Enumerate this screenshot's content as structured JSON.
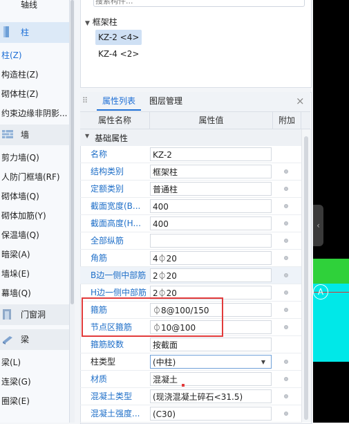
{
  "left_nav": {
    "top_item": "轴线",
    "items": [
      {
        "type": "group",
        "label": "柱",
        "icon": "column-icon",
        "active": true
      },
      {
        "type": "item",
        "label": "柱(Z)",
        "selected": true
      },
      {
        "type": "item",
        "label": "构造柱(Z)"
      },
      {
        "type": "item",
        "label": "砌体柱(Z)"
      },
      {
        "type": "item",
        "label": "约束边缘非阴影..."
      },
      {
        "type": "group",
        "label": "墙",
        "icon": "wall-icon"
      },
      {
        "type": "item",
        "label": "剪力墙(Q)"
      },
      {
        "type": "item",
        "label": "人防门框墙(RF)"
      },
      {
        "type": "item",
        "label": "砌体墙(Q)"
      },
      {
        "type": "item",
        "label": "砌体加筋(Y)"
      },
      {
        "type": "item",
        "label": "保温墙(Q)"
      },
      {
        "type": "item",
        "label": "暗梁(A)"
      },
      {
        "type": "item",
        "label": "墙垛(E)"
      },
      {
        "type": "item",
        "label": "幕墙(Q)"
      },
      {
        "type": "group",
        "label": "门窗洞",
        "icon": "door-window-icon"
      },
      {
        "type": "group",
        "label": "梁",
        "icon": "beam-icon"
      },
      {
        "type": "item",
        "label": "梁(L)"
      },
      {
        "type": "item",
        "label": "连梁(G)"
      },
      {
        "type": "item",
        "label": "圈梁(E)"
      }
    ]
  },
  "tree": {
    "search_placeholder": "搜索构件...",
    "category": "框架柱",
    "items": [
      {
        "label": "KZ-2 <4>",
        "selected": true
      },
      {
        "label": "KZ-4 <2>",
        "selected": false
      }
    ]
  },
  "prop_panel": {
    "tabs": [
      "属性列表",
      "图层管理"
    ],
    "close_glyph": "×",
    "columns": {
      "name": "属性名称",
      "value": "属性值",
      "extra": "附加"
    },
    "group_label": "基础属性",
    "rows": [
      {
        "name": "名称",
        "value": "KZ-2",
        "blue": true,
        "dot": false
      },
      {
        "name": "结构类别",
        "value": "框架柱",
        "blue": true,
        "dot": true
      },
      {
        "name": "定额类别",
        "value": "普通柱",
        "blue": true,
        "dot": true
      },
      {
        "name": "截面宽度(B...",
        "value": "400",
        "blue": true,
        "dot": true
      },
      {
        "name": "截面高度(H...",
        "value": "400",
        "blue": true,
        "dot": true
      },
      {
        "name": "全部纵筋",
        "value": "",
        "blue": true,
        "dot": true
      },
      {
        "name": "角筋",
        "value": "4⏀20",
        "blue": true,
        "dot": true
      },
      {
        "name": "B边一侧中部筋",
        "value": "2⏀20",
        "blue": true,
        "dot": true,
        "highlight": true
      },
      {
        "name": "H边一侧中部筋",
        "value": "2⏀20",
        "blue": true,
        "dot": true
      },
      {
        "name": "箍筋",
        "value": "⏀8@100/150",
        "blue": true,
        "dot": true
      },
      {
        "name": "节点区箍筋",
        "value": "⏀10@100",
        "blue": true,
        "dot": true
      },
      {
        "name": "箍筋胶数",
        "value": "按截面",
        "blue": true,
        "dot": false
      },
      {
        "name": "柱类型",
        "value": "(中柱)",
        "blue": false,
        "dot": true,
        "combo": true
      },
      {
        "name": "材质",
        "value": "混凝土",
        "blue": true,
        "dot": true
      },
      {
        "name": "混凝土类型",
        "value": "(现浇混凝土碎石<31.5)",
        "blue": true,
        "dot": true
      },
      {
        "name": "混凝土强度...",
        "value": "(C30)",
        "blue": true,
        "dot": true
      }
    ]
  },
  "canvas": {
    "axis_label": "A",
    "collapse_glyph": "‹",
    "colors": {
      "green": "#2fd13a",
      "cyan": "#00e8e8",
      "highlight": "#e23b3b",
      "accent": "#1e6fd6"
    }
  }
}
